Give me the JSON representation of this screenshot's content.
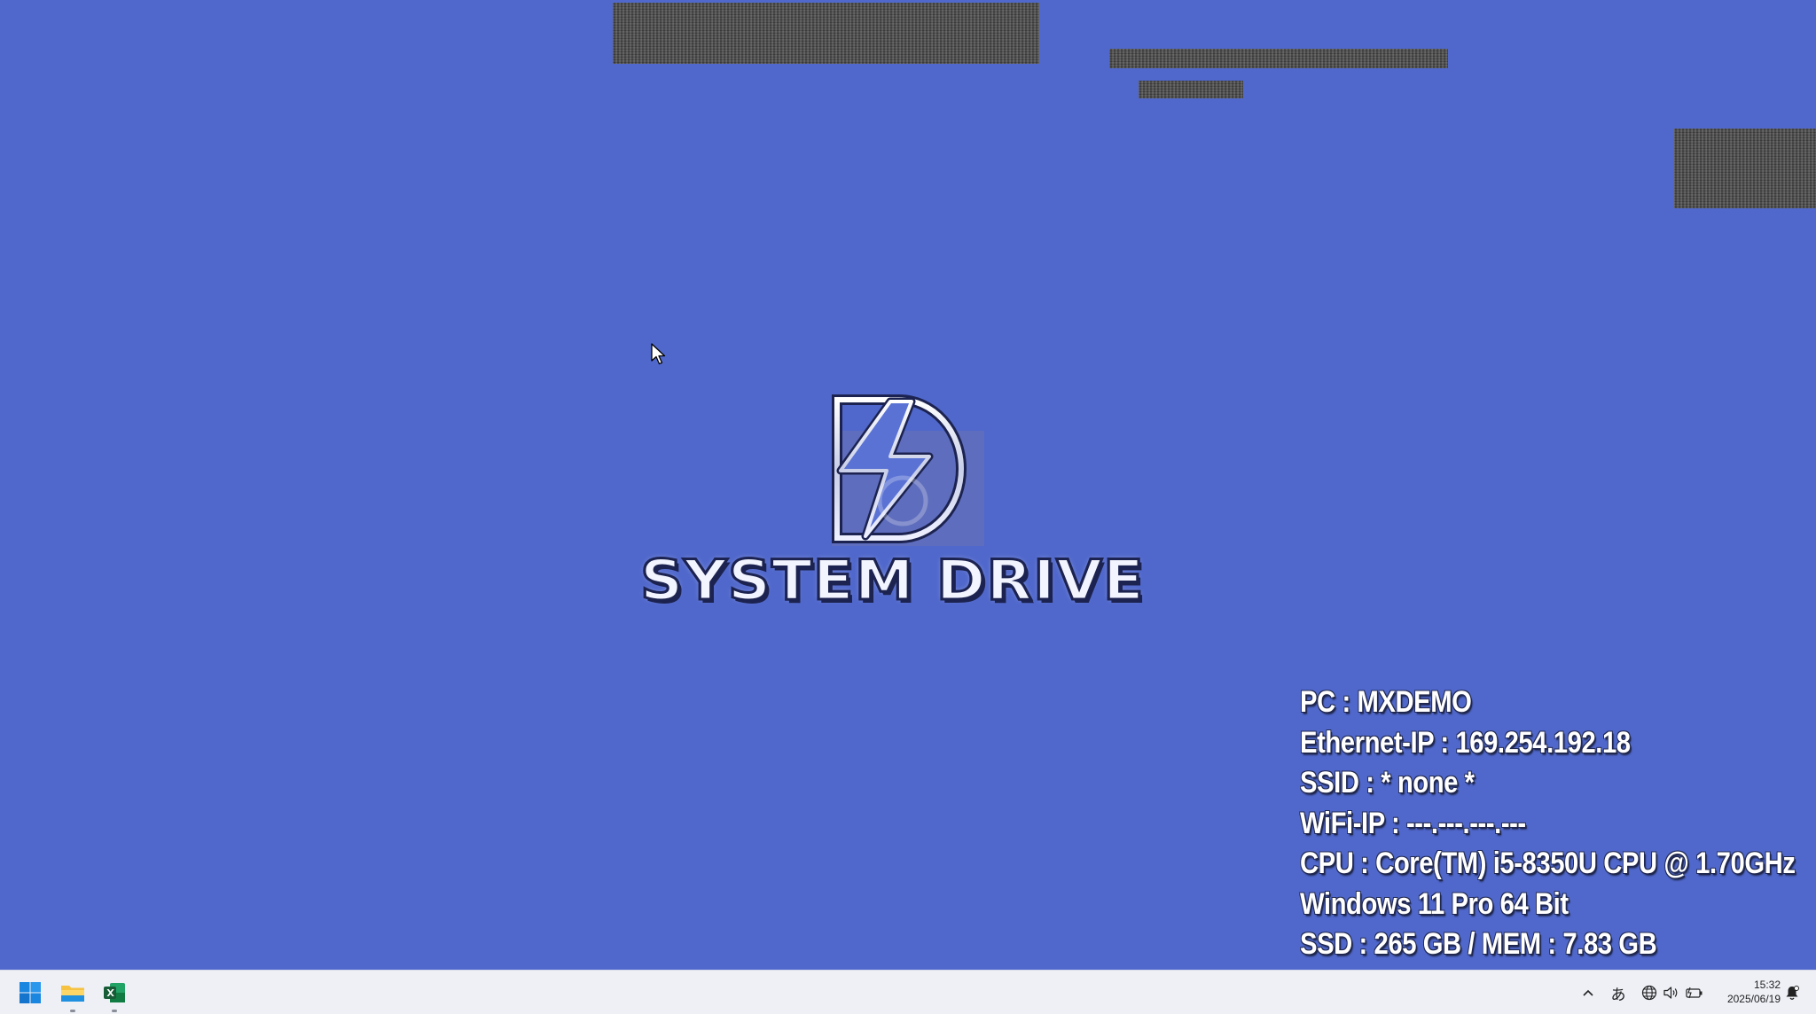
{
  "desktop": {
    "background_color": "#5068cc",
    "logo": {
      "text": "SYSTEM DRIVE",
      "icon": "lightning-d-logo-icon"
    },
    "sysinfo": [
      "PC : MXDEMO",
      "Ethernet-IP : 169.254.192.18",
      "SSID : * none *",
      "WiFi-IP : ---.---.---.---",
      "CPU : Core(TM) i5-8350U CPU @ 1.70GHz",
      "Windows 11 Pro 64 Bit",
      "SSD : 265 GB / MEM : 7.83 GB"
    ]
  },
  "taskbar": {
    "apps": [
      {
        "name": "start",
        "icon": "windows-start-icon"
      },
      {
        "name": "file-explorer",
        "icon": "folder-icon"
      },
      {
        "name": "excel",
        "icon": "excel-icon"
      }
    ],
    "tray": {
      "overflow_icon": "chevron-up-icon",
      "ime_label": "あ",
      "network_icon": "globe-icon",
      "volume_icon": "speaker-icon",
      "battery_icon": "battery-icon",
      "notification_icon": "notification-bell-icon"
    },
    "clock": {
      "time": "15:32",
      "date": "2025/06/19"
    }
  }
}
